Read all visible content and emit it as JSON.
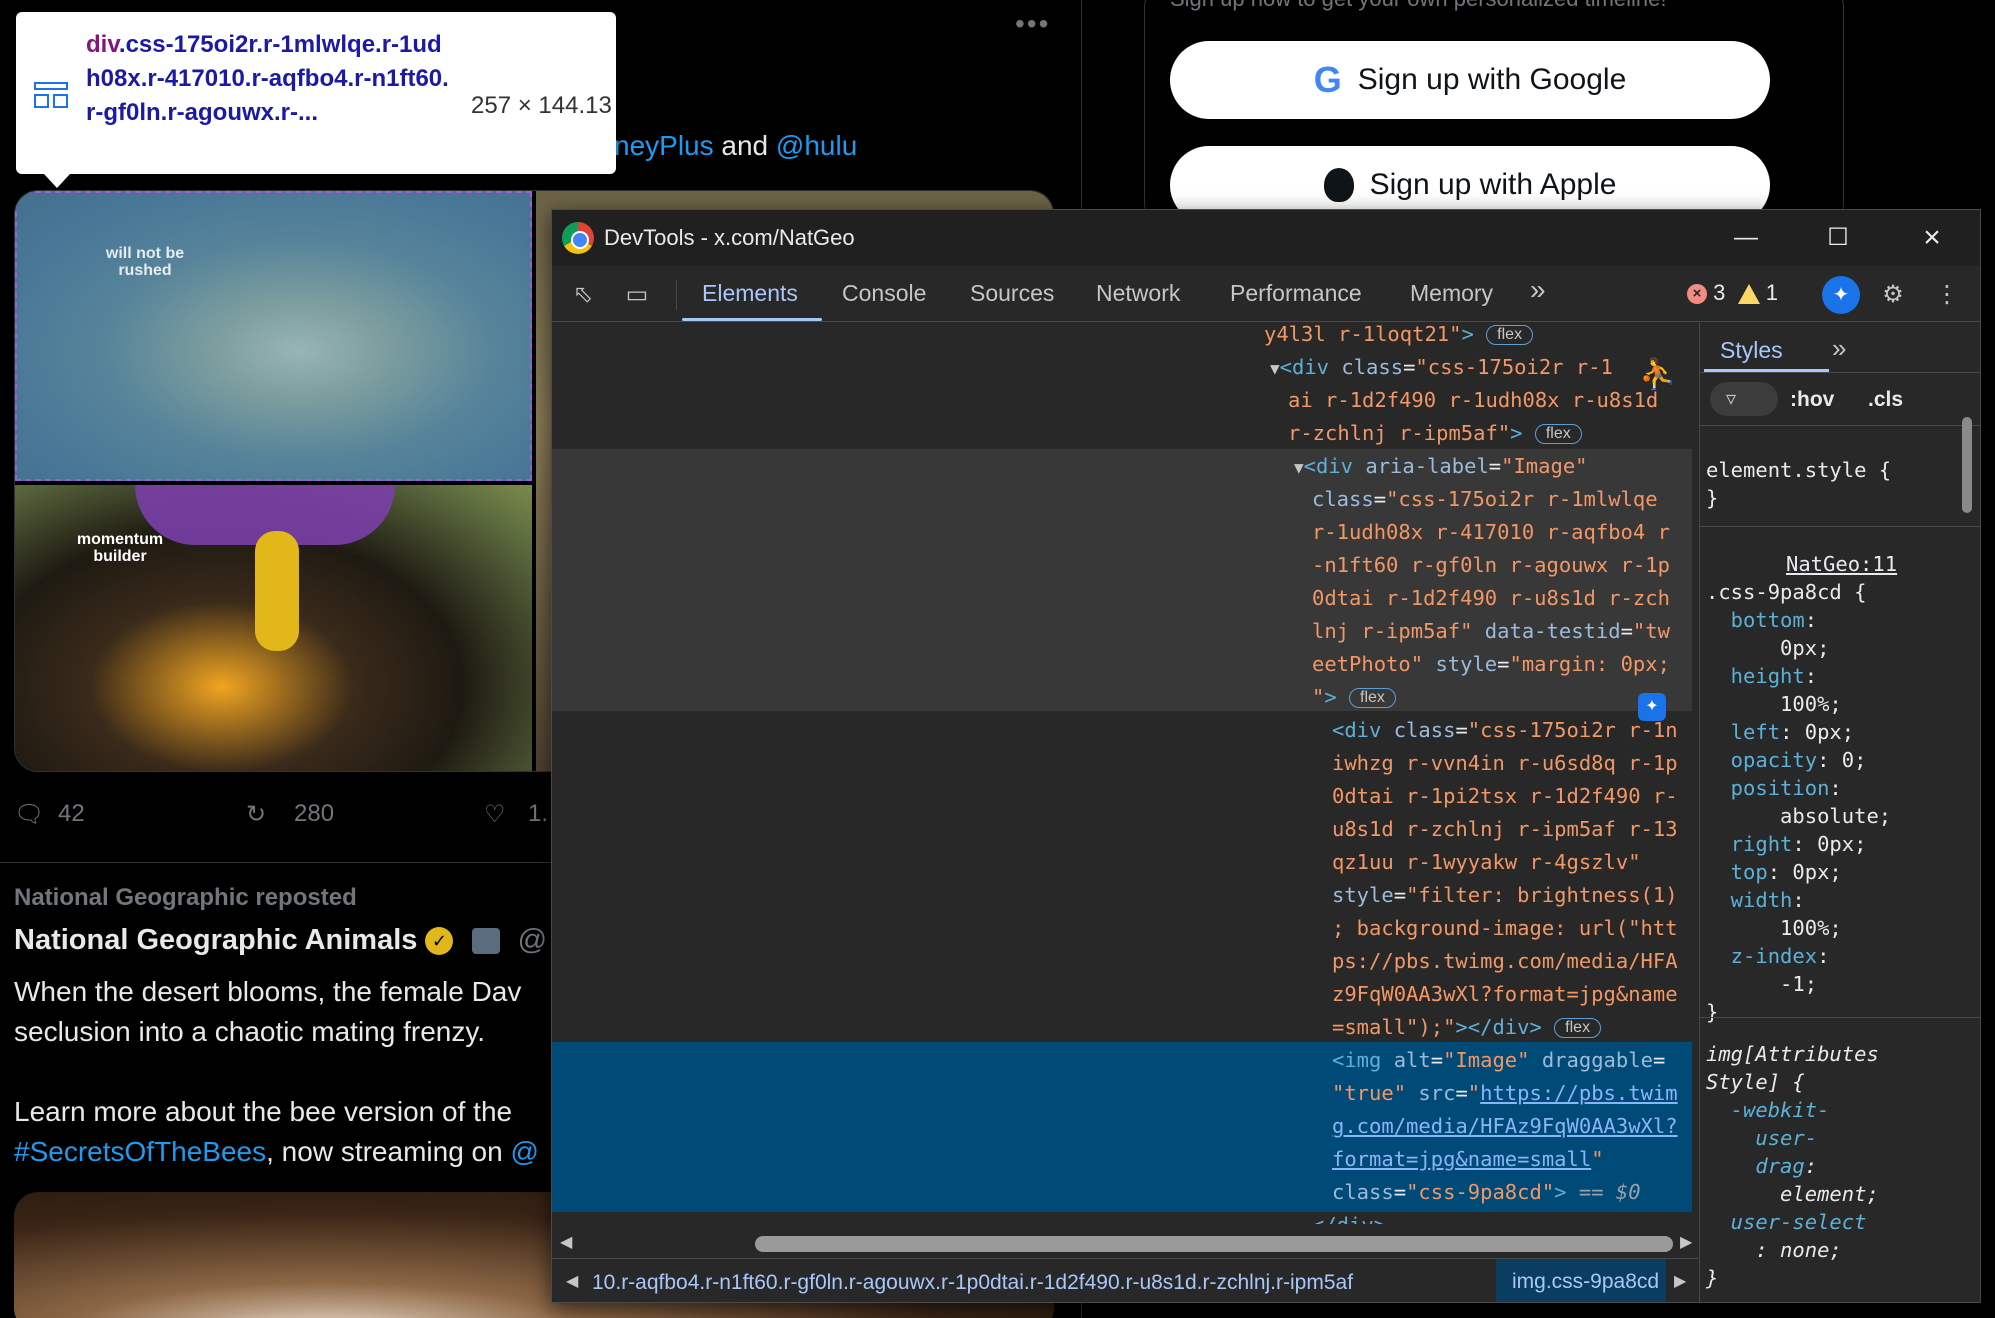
{
  "tweet1": {
    "line_tail": [
      "sneyPlus",
      " and ",
      "@hulu"
    ],
    "captions": [
      "will not be rushed",
      "momentum builder"
    ],
    "replies": "42",
    "reposts": "280",
    "likes": "1."
  },
  "tweet2": {
    "reposted_label": "National Geographic reposted",
    "author": "National Geographic Animals",
    "handle": "@",
    "line1": "When the desert blooms, the female Dav",
    "line2": "seclusion into a chaotic mating frenzy.",
    "line3": "Learn more about the bee version of the",
    "hashtag": "#SecretsOfTheBees",
    "line4_tail": ", now streaming on ",
    "line4_link": "@"
  },
  "sidebar": {
    "subtitle": "Sign up now to get your own personalized timeline!",
    "google_label": "Sign up with Google",
    "apple_label": "Sign up with Apple"
  },
  "tooltip": {
    "tag": "div",
    "selector": ".css-175oi2r.r-1mlwlqe.r-1udh08x.r-417010.r-aqfbo4.r-n1ft60.r-gf0ln.r-agouwx.r-...",
    "size": "257 × 144.13"
  },
  "devtools": {
    "title": "DevTools - x.com/NatGeo",
    "tabs": [
      "Elements",
      "Console",
      "Sources",
      "Network",
      "Performance",
      "Memory"
    ],
    "more_tabs": "»",
    "errors": "3",
    "warnings": "1",
    "flex": "flex",
    "breadcrumb_left": "10.r-aqfbo4.r-n1ft60.r-gf0ln.r-agouwx.r-1p0dtai.r-1d2f490.r-u8s1d.r-zchlnj.r-ipm5af",
    "breadcrumb_right": "img.css-9pa8cd",
    "styles_tab": "Styles",
    "filter_hov": ":hov",
    "filter_cls": ".cls",
    "element_style": "element.style {",
    "rule_source": "NatGeo:11",
    "rule_selector": ".css-9pa8cd {",
    "attr_style_selector": "img[Attributes Style] {"
  },
  "colors": {
    "twitter_link": "#1d9bf0",
    "devtools_selected": "#004a77",
    "devtools_accent": "#a8c7fa",
    "overlay": "#6fa8dc"
  }
}
